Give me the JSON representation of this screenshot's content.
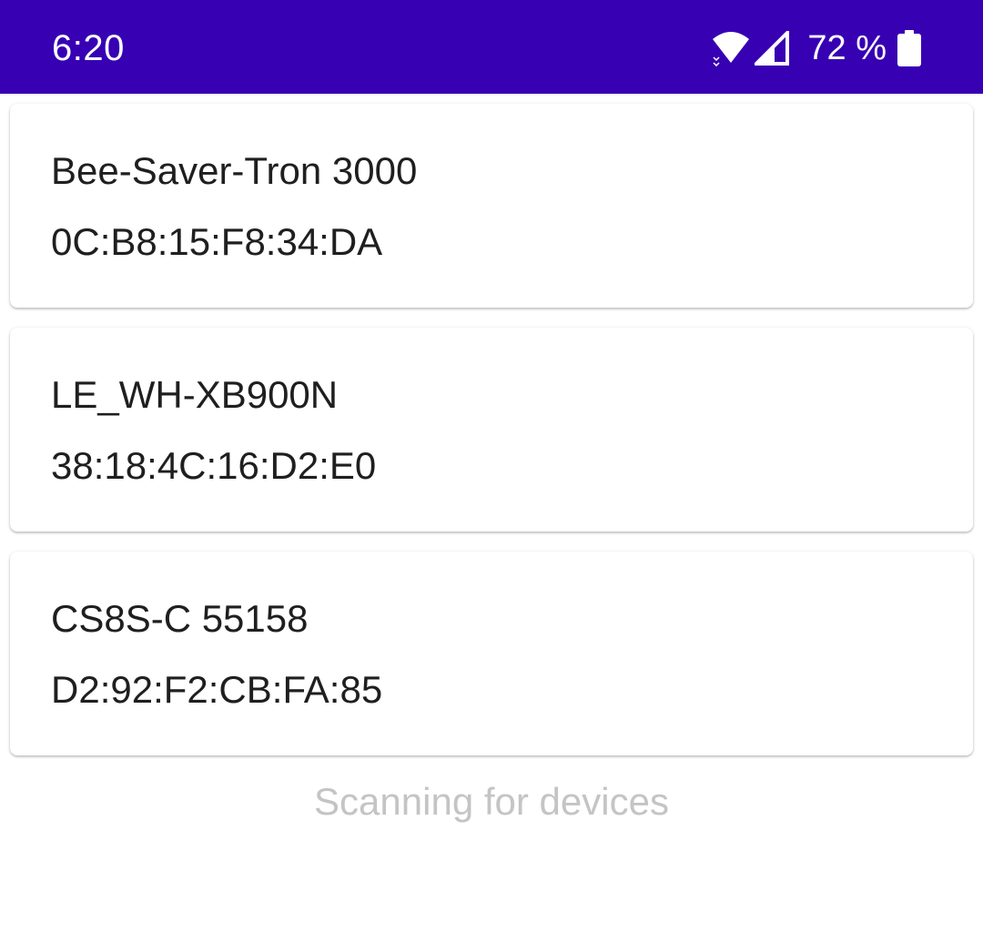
{
  "status_bar": {
    "time": "6:20",
    "battery": "72 %",
    "background_color": "#3700b3",
    "icons": [
      "wifi-icon",
      "cell-signal-icon",
      "battery-icon"
    ]
  },
  "devices": [
    {
      "name": "Bee-Saver-Tron 3000",
      "address": "0C:B8:15:F8:34:DA"
    },
    {
      "name": "LE_WH-XB900N",
      "address": "38:18:4C:16:D2:E0"
    },
    {
      "name": "CS8S-C 55158",
      "address": "D2:92:F2:CB:FA:85"
    }
  ],
  "footer": {
    "status": "Scanning for devices"
  }
}
